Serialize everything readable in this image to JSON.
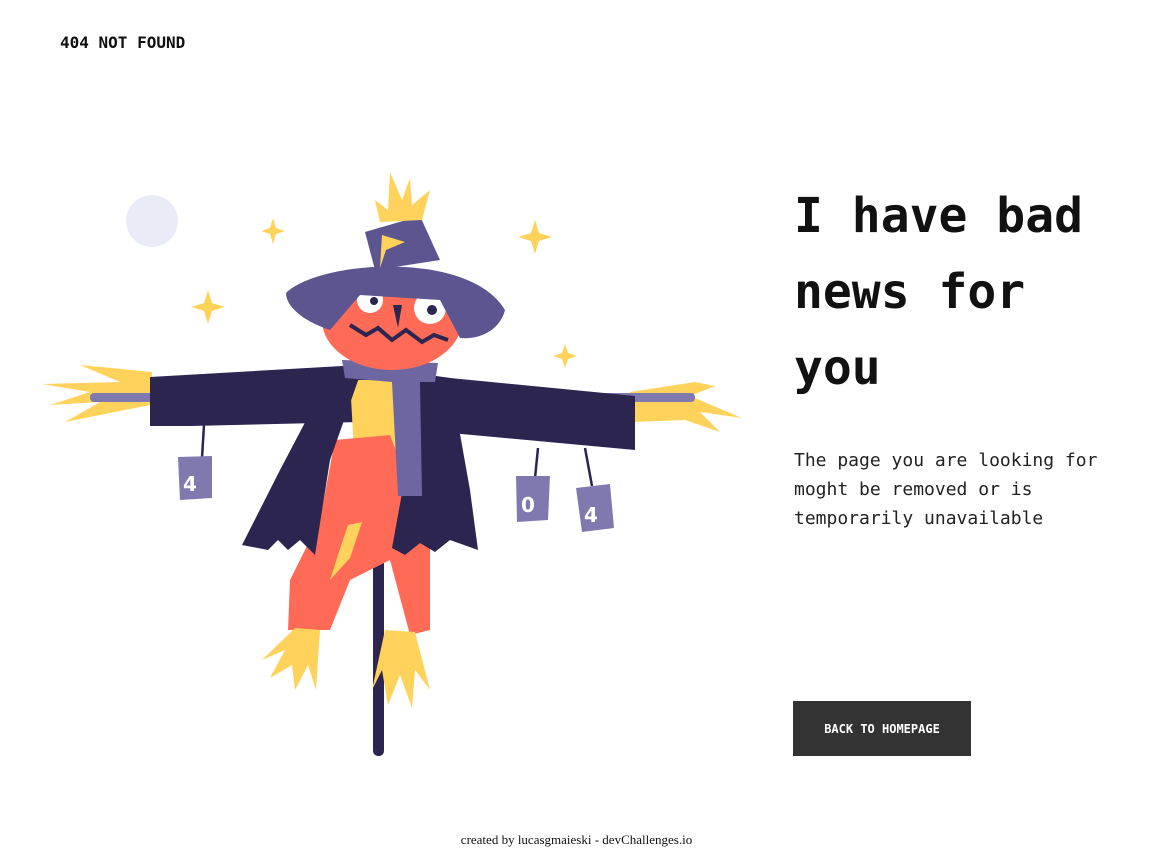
{
  "header": {
    "brand": "404 NOT FOUND"
  },
  "illustration": {
    "cans": [
      "4",
      "0",
      "4"
    ],
    "colors": {
      "hat": "#5c5590",
      "coat": "#2b2550",
      "face": "#ff6b57",
      "straw": "#ffd35b",
      "moon": "#e9ecf6",
      "scarf": "#6e66a0",
      "can": "#8079b0"
    }
  },
  "main": {
    "headline": "I have bad news for you",
    "message": "The page you are looking for moght be removed or is temporarily unavailable",
    "cta_label": "BACK TO HOMEPAGE"
  },
  "footer": {
    "credit": "created by lucasgmaieski - devChallenges.io"
  }
}
